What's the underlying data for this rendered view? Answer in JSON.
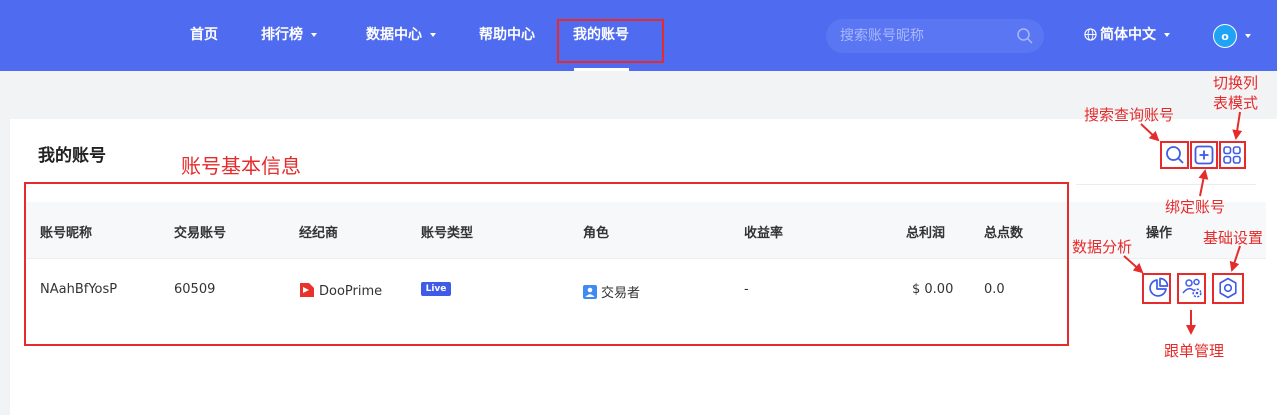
{
  "nav": {
    "items": [
      {
        "label": "首页",
        "dropdown": false
      },
      {
        "label": "排行榜",
        "dropdown": true
      },
      {
        "label": "数据中心",
        "dropdown": true
      },
      {
        "label": "帮助中心",
        "dropdown": false
      },
      {
        "label": "我的账号",
        "dropdown": false,
        "active": true
      }
    ],
    "search_placeholder": "搜索账号昵称",
    "language": "简体中文",
    "avatar_initial": "o",
    "bg_color": "#4f6bf0"
  },
  "page": {
    "title": "我的账号",
    "toolbar_icons": [
      "search-icon",
      "plus-square-icon",
      "grid-icon"
    ]
  },
  "table": {
    "headers": [
      "账号昵称",
      "交易账号",
      "经纪商",
      "账号类型",
      "角色",
      "收益率",
      "总利润",
      "总点数",
      "操作"
    ],
    "rows": [
      {
        "nickname": "NAahBfYosP",
        "account": "60509",
        "broker": "DooPrime",
        "type": "Live",
        "role": "交易者",
        "yield": "-",
        "profit": "$ 0.00",
        "points": "0.0",
        "actions": [
          "pie-chart-icon",
          "users-icon",
          "gear-icon"
        ]
      }
    ]
  },
  "annotations": {
    "basic_info": "账号基本信息",
    "search": "搜索查询账号",
    "switch_1": "切换列",
    "switch_2": "表模式",
    "bind": "绑定账号",
    "analysis": "数据分析",
    "settings": "基础设置",
    "follow": "跟单管理",
    "color": "#e52b2b"
  }
}
